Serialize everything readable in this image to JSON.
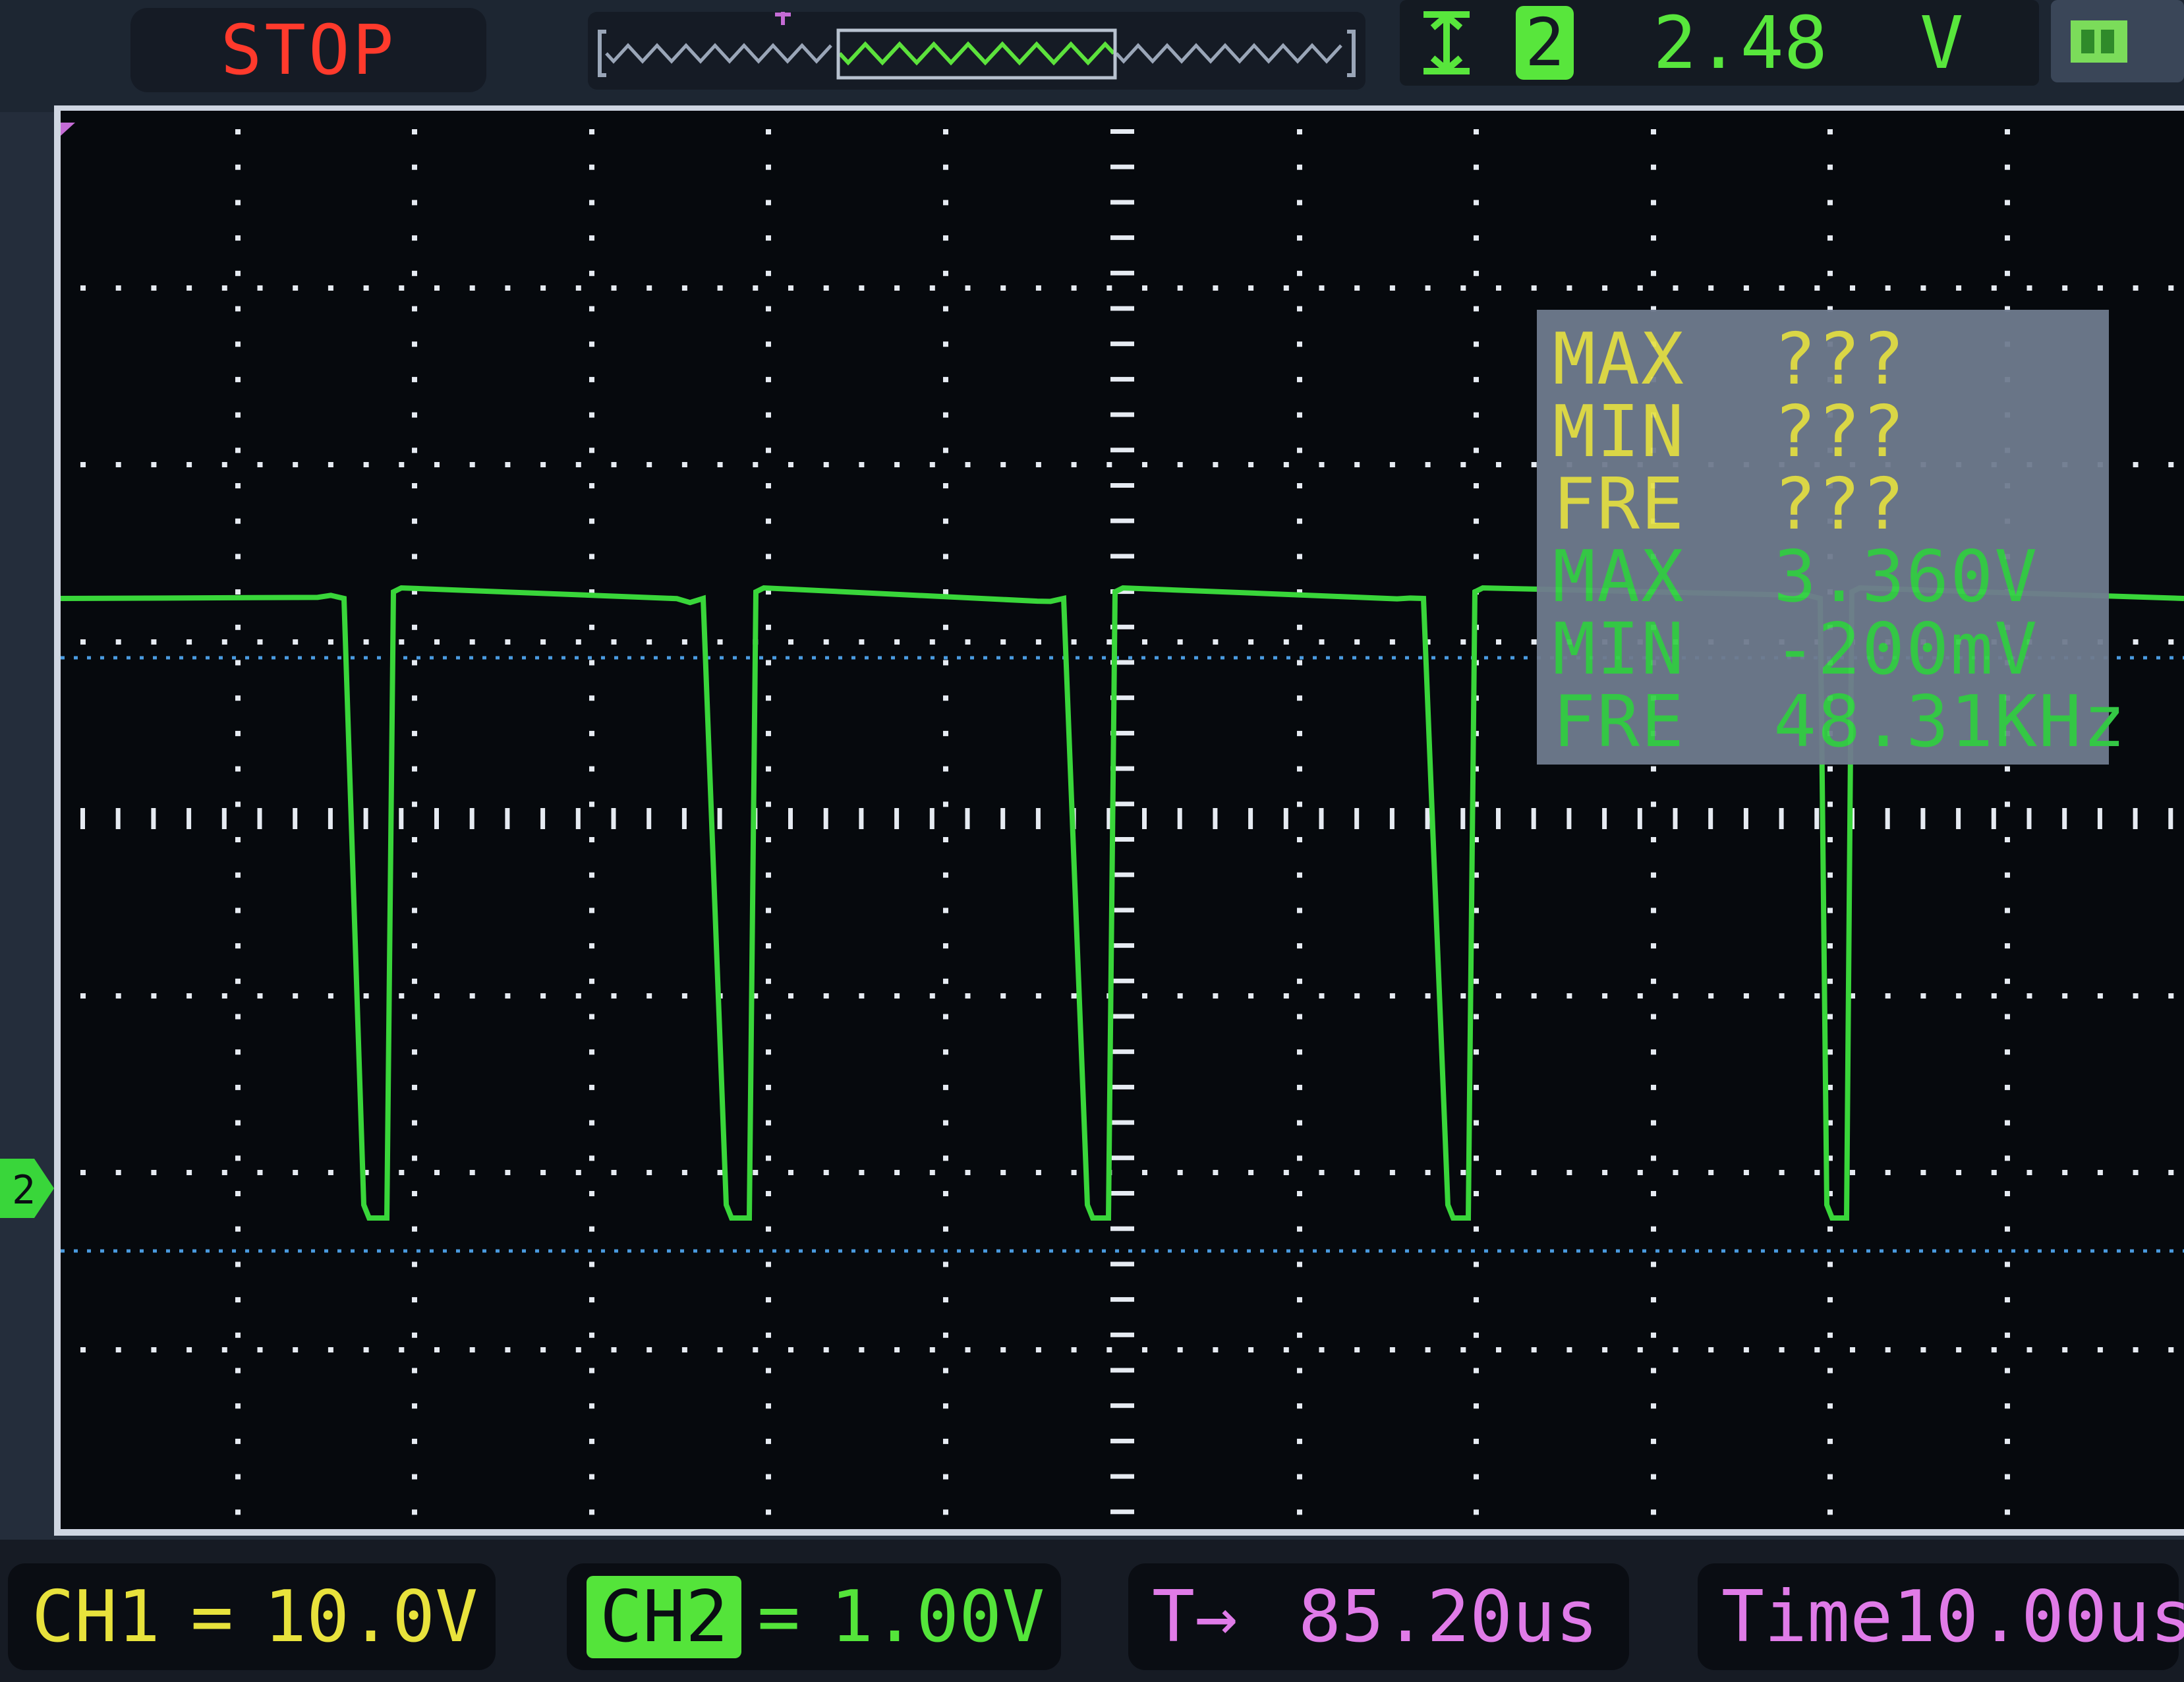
{
  "top": {
    "run_state": "STOP",
    "trigger_icon": "trigger-arrows-icon",
    "trigger_channel": "2",
    "trigger_level": "2.48",
    "trigger_unit": "V",
    "battery_icon": "battery-icon"
  },
  "measurements": {
    "ch1": [
      {
        "label": "MAX",
        "value": "???"
      },
      {
        "label": "MIN",
        "value": "???"
      },
      {
        "label": "FRE",
        "value": "???"
      }
    ],
    "ch2": [
      {
        "label": "MAX",
        "value": "3.360V"
      },
      {
        "label": "MIN",
        "value": "-200mV"
      },
      {
        "label": "FRE",
        "value": "48.31KHz"
      }
    ]
  },
  "bottom": {
    "ch1_label": "CH1",
    "ch1_coupling": "=",
    "ch1_scale": "10.0V",
    "ch2_label": "CH2",
    "ch2_coupling": "=",
    "ch2_scale": "1.00V",
    "trigger_pos_label": "T→",
    "trigger_pos_value": "85.20us",
    "timebase_label": "Time",
    "timebase_value": "10.00us"
  },
  "colors": {
    "trace": "#39d63a",
    "ch1": "#e8e23c",
    "ch2": "#54e43a",
    "stop": "#ff3a2c",
    "time": "#e07be8",
    "cursor": "#4a9be0"
  }
}
